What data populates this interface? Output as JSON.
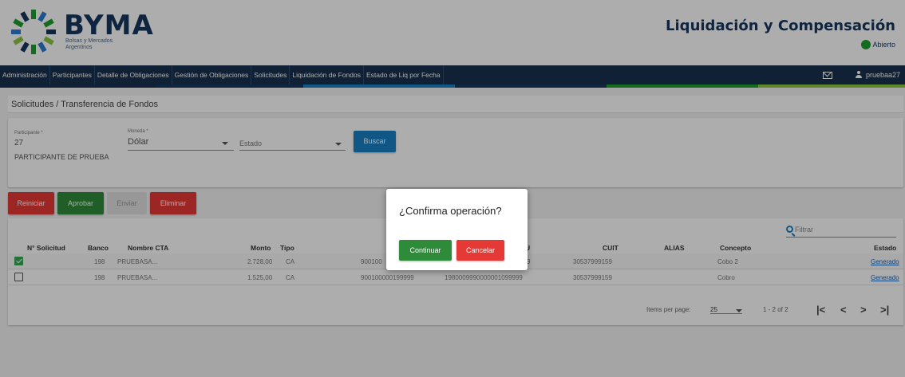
{
  "header": {
    "brand": "BYMA",
    "brand_sub_1": "Bolsas y Mercados",
    "brand_sub_2": "Argentinos",
    "app_title": "Liquidación y Compensación",
    "market_status": "Abierto",
    "colors": {
      "brand": "#17355e",
      "status_open": "#1b9e2e"
    }
  },
  "nav": {
    "items": [
      "Administración",
      "Participantes",
      "Detalle de Obligaciones",
      "Gestión de Obligaciones",
      "Solicitudes",
      "Liquidación de Fondos",
      "Estado de Liq por Fecha"
    ],
    "user": "pruebaa27",
    "mail_icon": "mail-icon",
    "user_icon": "person-icon",
    "bg_color": "#18304f"
  },
  "breadcrumb": "Solicitudes / Transferencia de Fondos",
  "filters": {
    "participante_label": "Participante *",
    "participante_value": "27",
    "participante_name": "PARTICIPANTE DE PRUEBA",
    "moneda_label": "Moneda *",
    "moneda_value": "Dólar",
    "estado_placeholder": "Estado",
    "search_button": "Buscar"
  },
  "actions": {
    "reset": "Reiniciar",
    "approve": "Aprobar",
    "send": "Enviar",
    "delete": "Eliminar"
  },
  "table": {
    "filter_placeholder": "Filtrar",
    "headers": {
      "num": "N° Solicitud",
      "bank": "Banco",
      "name": "Nombre CTA",
      "amount": "Monto",
      "type": "Tipo",
      "cbu_fragment": "U",
      "cuit": "CUIT",
      "alias": "ALIAS",
      "concept": "Concepto",
      "status": "Estado"
    },
    "rows": [
      {
        "checked": true,
        "bank": "198",
        "name": "PRUEBASA...",
        "amount": "2.728,00",
        "type": "CA",
        "account_fragment": "900100",
        "cbu_fragment": "9",
        "cuit": "30537999159",
        "alias": "",
        "concept": "Cobo 2",
        "status": "Generado"
      },
      {
        "checked": false,
        "bank": "198",
        "name": "PRUEBASA...",
        "amount": "1.525,00",
        "type": "CA",
        "account": "900100000199999",
        "cbu": "1980009990000001099999",
        "cuit": "30537999159",
        "alias": "",
        "concept": "Cobro",
        "status": "Generado"
      }
    ],
    "paginator": {
      "items_per_page_label": "Items per page:",
      "page_size": "25",
      "range": "1 - 2 of 2",
      "first": "|<",
      "prev": "<",
      "next": ">",
      "last": ">|"
    }
  },
  "dialog": {
    "title": "¿Confirma operación?",
    "continue": "Continuar",
    "cancel": "Cancelar"
  }
}
